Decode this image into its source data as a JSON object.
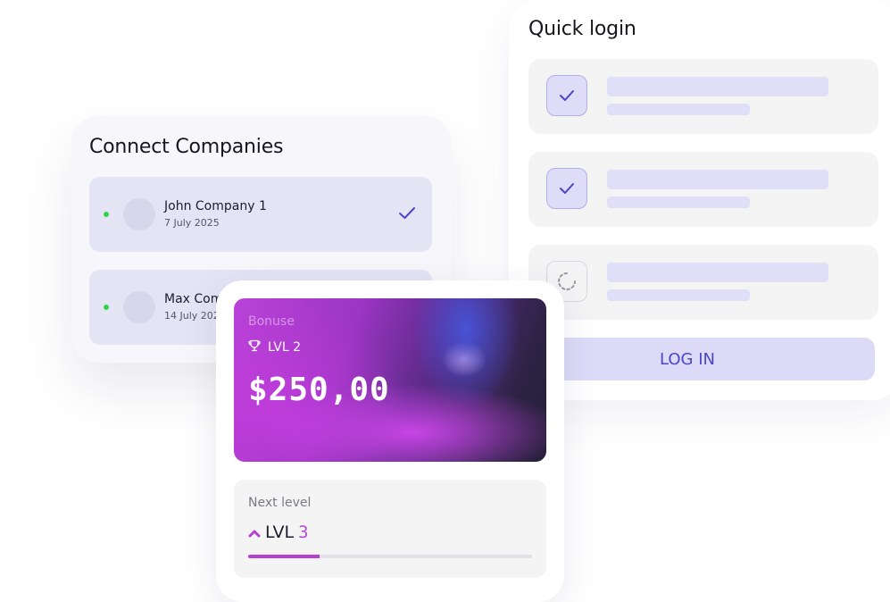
{
  "quick_login": {
    "title": "Quick login",
    "rows": [
      {
        "state": "checked",
        "icon": "check-icon"
      },
      {
        "state": "checked",
        "icon": "check-icon"
      },
      {
        "state": "loading",
        "icon": "spinner-icon"
      }
    ],
    "login_label": "LOG IN"
  },
  "connect_companies": {
    "title": "Connect Companies",
    "items": [
      {
        "name": "John Company 1",
        "date": "7 July 2025",
        "status": "online",
        "connected": true
      },
      {
        "name": "Max Company",
        "date": "14 July 2025",
        "status": "online",
        "connected": false
      }
    ]
  },
  "bonus": {
    "label": "Bonuse",
    "level": "LVL 2",
    "amount": "$250,00",
    "next_label": "Next level",
    "next_level_prefix": "LVL",
    "next_level_number": "3",
    "progress": 0.25
  },
  "colors": {
    "accent": "#4c45c9",
    "online": "#2fd44b",
    "progress": "#b540d2",
    "next_level_number": "#b54bd2"
  }
}
